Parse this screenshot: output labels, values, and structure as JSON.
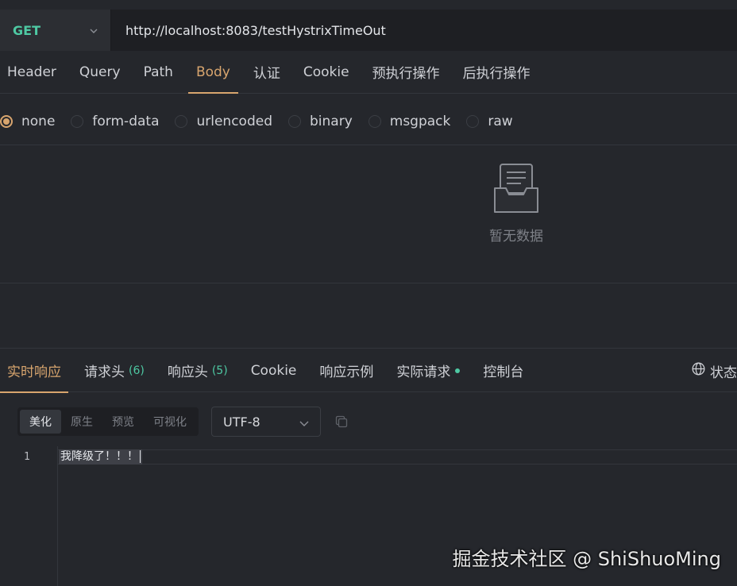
{
  "request": {
    "method": "GET",
    "url": "http://localhost:8083/testHystrixTimeOut",
    "tabs": [
      "Header",
      "Query",
      "Path",
      "Body",
      "认证",
      "Cookie",
      "预执行操作",
      "后执行操作"
    ],
    "active_tab": "Body",
    "body_types": [
      "none",
      "form-data",
      "urlencoded",
      "binary",
      "msgpack",
      "raw"
    ],
    "selected_body_type": "none",
    "empty_text": "暂无数据"
  },
  "response": {
    "tabs": {
      "realtime": "实时响应",
      "request_headers": "请求头",
      "request_headers_count": "(6)",
      "response_headers": "响应头",
      "response_headers_count": "(5)",
      "cookie": "Cookie",
      "example": "响应示例",
      "actual_request": "实际请求",
      "console": "控制台"
    },
    "status_label": "状态",
    "view_modes": [
      "美化",
      "原生",
      "预览",
      "可视化"
    ],
    "active_view_mode": "美化",
    "encoding": "UTF-8",
    "body_lines": [
      {
        "num": "1",
        "text": "我降级了！！！"
      }
    ]
  },
  "watermark": "掘金技术社区 @ ShiShuoMing",
  "colors": {
    "accent": "#d8a56e",
    "method_green": "#4ec9a3",
    "background": "#25272c"
  }
}
